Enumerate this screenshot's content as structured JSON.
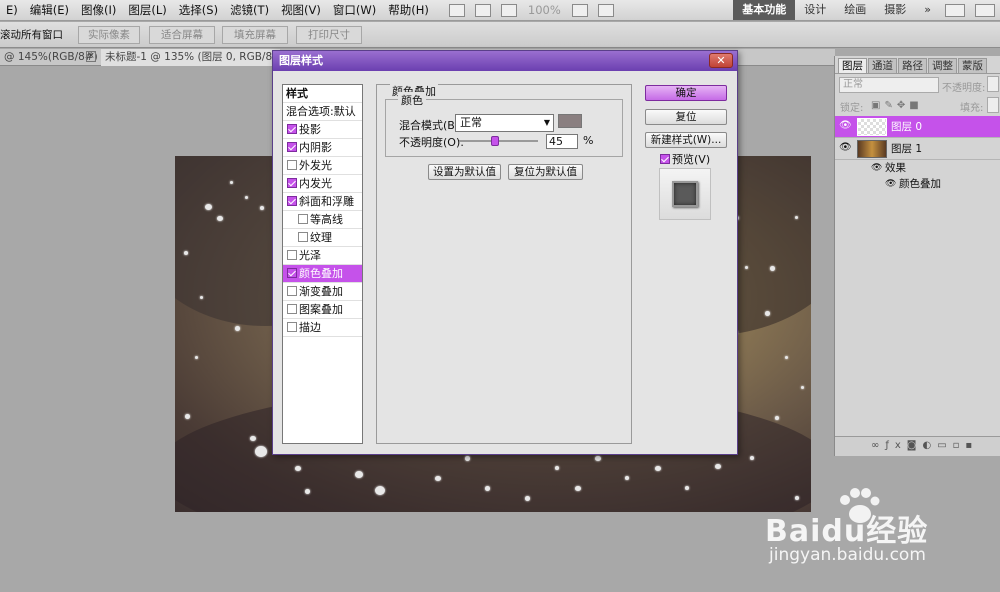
{
  "menubar": {
    "items": [
      "E)",
      "编辑(E)",
      "图像(I)",
      "图层(L)",
      "选择(S)",
      "滤镜(T)",
      "视图(V)",
      "窗口(W)",
      "帮助(H)"
    ],
    "zoom": "100%",
    "workspaces": [
      "基本功能",
      "设计",
      "绘画",
      "摄影"
    ]
  },
  "options": {
    "scroll_all": "滚动所有窗口",
    "actual_pixels": "实际像素",
    "fit_screen": "适合屏幕",
    "fill_screen": "填充屏幕",
    "print_size": "打印尺寸"
  },
  "doctabs": {
    "tab1": "@ 145%(RGB/8#)",
    "tab2": "未标题-1 @ 135% (图层 0, RGB/8)"
  },
  "panel": {
    "tabs": [
      "图层",
      "通道",
      "路径",
      "调整",
      "蒙版"
    ],
    "blend_mode": "正常",
    "opacity_label": "不透明度:",
    "lock_label": "锁定:",
    "fill_label": "填充:",
    "layers": [
      {
        "name": "图层 0"
      },
      {
        "name": "图层 1"
      },
      {
        "name": "效果"
      },
      {
        "name": "颜色叠加"
      }
    ]
  },
  "dialog": {
    "title": "图层样式",
    "styles_header": "样式",
    "blend_options": "混合选项:默认",
    "styles": [
      {
        "label": "投影",
        "checked": true
      },
      {
        "label": "内阴影",
        "checked": true
      },
      {
        "label": "外发光",
        "checked": false
      },
      {
        "label": "内发光",
        "checked": true
      },
      {
        "label": "斜面和浮雕",
        "checked": true
      },
      {
        "label": "等高线",
        "checked": false
      },
      {
        "label": "纹理",
        "checked": false
      },
      {
        "label": "光泽",
        "checked": false
      },
      {
        "label": "颜色叠加",
        "checked": true
      },
      {
        "label": "渐变叠加",
        "checked": false
      },
      {
        "label": "图案叠加",
        "checked": false
      },
      {
        "label": "描边",
        "checked": false
      }
    ],
    "section_title": "颜色叠加",
    "group_title": "颜色",
    "blend_mode_label": "混合模式(B):",
    "blend_mode_value": "正常",
    "swatch_color": "#8a7f80",
    "opacity_label": "不透明度(O):",
    "opacity_value": "45",
    "opacity_unit": "%",
    "opacity_fraction": 0.45,
    "set_default": "设置为默认值",
    "reset_default": "复位为默认值",
    "ok": "确定",
    "reset": "复位",
    "new_style": "新建样式(W)...",
    "preview": "预览(V)"
  },
  "watermark": {
    "brand": "Baidu经验",
    "url": "jingyan.baidu.com"
  },
  "colors": {
    "accent": "#c552ea",
    "title_bar": "#7d4cc0"
  }
}
